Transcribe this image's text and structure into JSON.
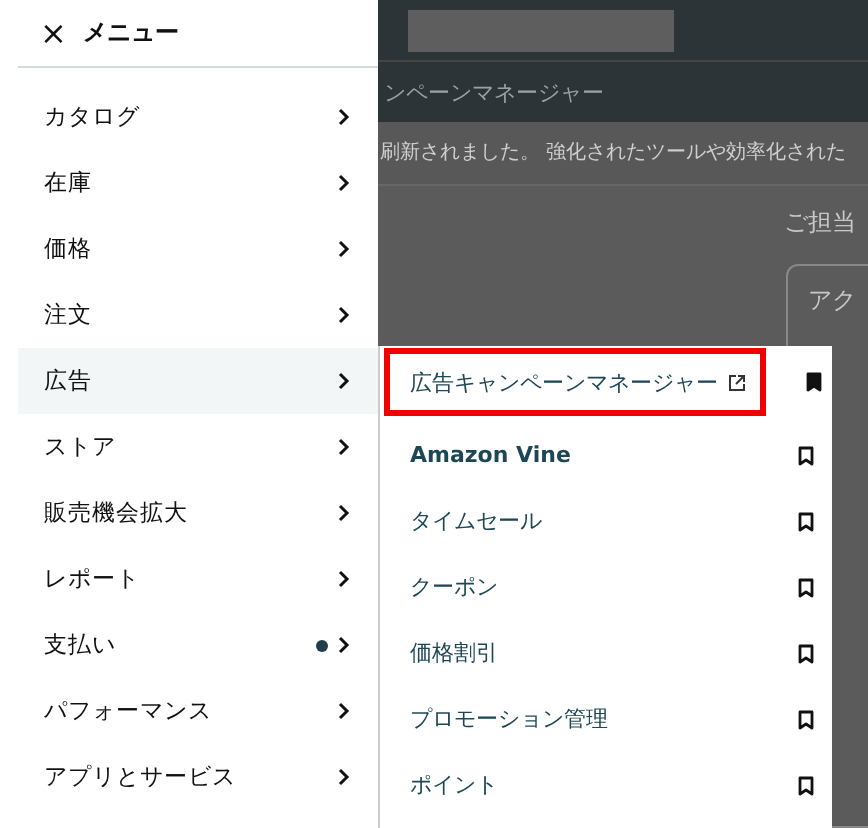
{
  "background": {
    "breadcrumb": "ンペーンマネージャー",
    "banner": "刷新されました。 強化されたツールや効率化された",
    "greeting": "ご担当",
    "card_title": "アク"
  },
  "menu": {
    "close": "×",
    "title": "メニュー",
    "items": [
      {
        "label": "カタログ",
        "selected": false,
        "dot": false
      },
      {
        "label": "在庫",
        "selected": false,
        "dot": false
      },
      {
        "label": "価格",
        "selected": false,
        "dot": false
      },
      {
        "label": "注文",
        "selected": false,
        "dot": false
      },
      {
        "label": "広告",
        "selected": true,
        "dot": false
      },
      {
        "label": "ストア",
        "selected": false,
        "dot": false
      },
      {
        "label": "販売機会拡大",
        "selected": false,
        "dot": false
      },
      {
        "label": "レポート",
        "selected": false,
        "dot": false
      },
      {
        "label": "支払い",
        "selected": false,
        "dot": true
      },
      {
        "label": "パフォーマンス",
        "selected": false,
        "dot": false
      },
      {
        "label": "アプリとサービス",
        "selected": false,
        "dot": false
      }
    ]
  },
  "submenu": {
    "items": [
      {
        "label": "広告キャンペーンマネージャー",
        "external": true,
        "pinned": true,
        "highlighted": true
      },
      {
        "label": "Amazon Vine",
        "external": false,
        "pinned": false,
        "highlighted": false
      },
      {
        "label": "タイムセール",
        "external": false,
        "pinned": false,
        "highlighted": false
      },
      {
        "label": "クーポン",
        "external": false,
        "pinned": false,
        "highlighted": false
      },
      {
        "label": "価格割引",
        "external": false,
        "pinned": false,
        "highlighted": false
      },
      {
        "label": "プロモーション管理",
        "external": false,
        "pinned": false,
        "highlighted": false
      },
      {
        "label": "ポイント",
        "external": false,
        "pinned": false,
        "highlighted": false
      }
    ]
  }
}
